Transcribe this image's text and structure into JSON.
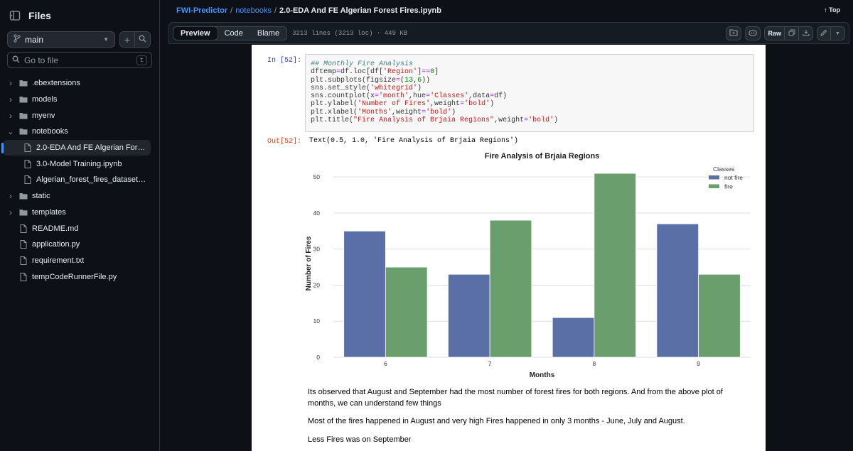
{
  "sidebar": {
    "title": "Files",
    "branch": "main",
    "search_placeholder": "Go to file",
    "search_shortcut": "t",
    "tree": [
      {
        "label": ".ebextensions",
        "type": "folder",
        "expanded": false
      },
      {
        "label": "models",
        "type": "folder",
        "expanded": false
      },
      {
        "label": "myenv",
        "type": "folder",
        "expanded": false
      },
      {
        "label": "notebooks",
        "type": "folder",
        "expanded": true
      },
      {
        "label": "2.0-EDA And FE Algerian Forest Fires.ipynb",
        "type": "child-file",
        "selected": true
      },
      {
        "label": "3.0-Model Training.ipynb",
        "type": "child-file"
      },
      {
        "label": "Algerian_forest_fires_dataset_UPDATE.csv",
        "type": "child-file"
      },
      {
        "label": "static",
        "type": "folder",
        "expanded": false
      },
      {
        "label": "templates",
        "type": "folder",
        "expanded": false
      },
      {
        "label": "README.md",
        "type": "file"
      },
      {
        "label": "application.py",
        "type": "file"
      },
      {
        "label": "requirement.txt",
        "type": "file"
      },
      {
        "label": "tempCodeRunnerFile.py",
        "type": "file"
      }
    ]
  },
  "breadcrumb": {
    "repo": "FWI-Predictor",
    "folder": "notebooks",
    "file": "2.0-EDA And FE Algerian Forest Fires.ipynb",
    "sep": "/"
  },
  "top_link": "Top",
  "toolbar": {
    "tabs": [
      "Preview",
      "Code",
      "Blame"
    ],
    "active_tab": "Preview",
    "meta": "3213 lines (3213 loc) · 449 KB",
    "raw_label": "Raw"
  },
  "notebook": {
    "in_prompt": "In [52]:",
    "out_prompt": "Out[52]:",
    "output_text": "Text(0.5, 1.0, 'Fire Analysis of Brjaia Regions')",
    "markdown": [
      "Its observed that August and September had the most number of forest fires for both regions. And from the above plot of months, we can understand few things",
      "Most of the fires happened in August and very high Fires happened in only 3 months - June, July and August.",
      "Less Fires was on September"
    ]
  },
  "colors": {
    "not_fire": "#5a6fa5",
    "fire": "#6a9e6c",
    "link": "#4493f8"
  },
  "chart_data": {
    "type": "bar",
    "title": "Fire Analysis of Brjaia Regions",
    "xlabel": "Months",
    "ylabel": "Number of Fires",
    "categories": [
      "6",
      "7",
      "8",
      "9"
    ],
    "series": [
      {
        "name": "not fire",
        "values": [
          35,
          23,
          11,
          37
        ]
      },
      {
        "name": "fire",
        "values": [
          25,
          38,
          51,
          23
        ]
      }
    ],
    "legend_title": "Classes",
    "legend_position": "top-right",
    "ylim": [
      0,
      52
    ],
    "yticks": [
      0,
      10,
      20,
      30,
      40,
      50
    ],
    "grid": true
  }
}
